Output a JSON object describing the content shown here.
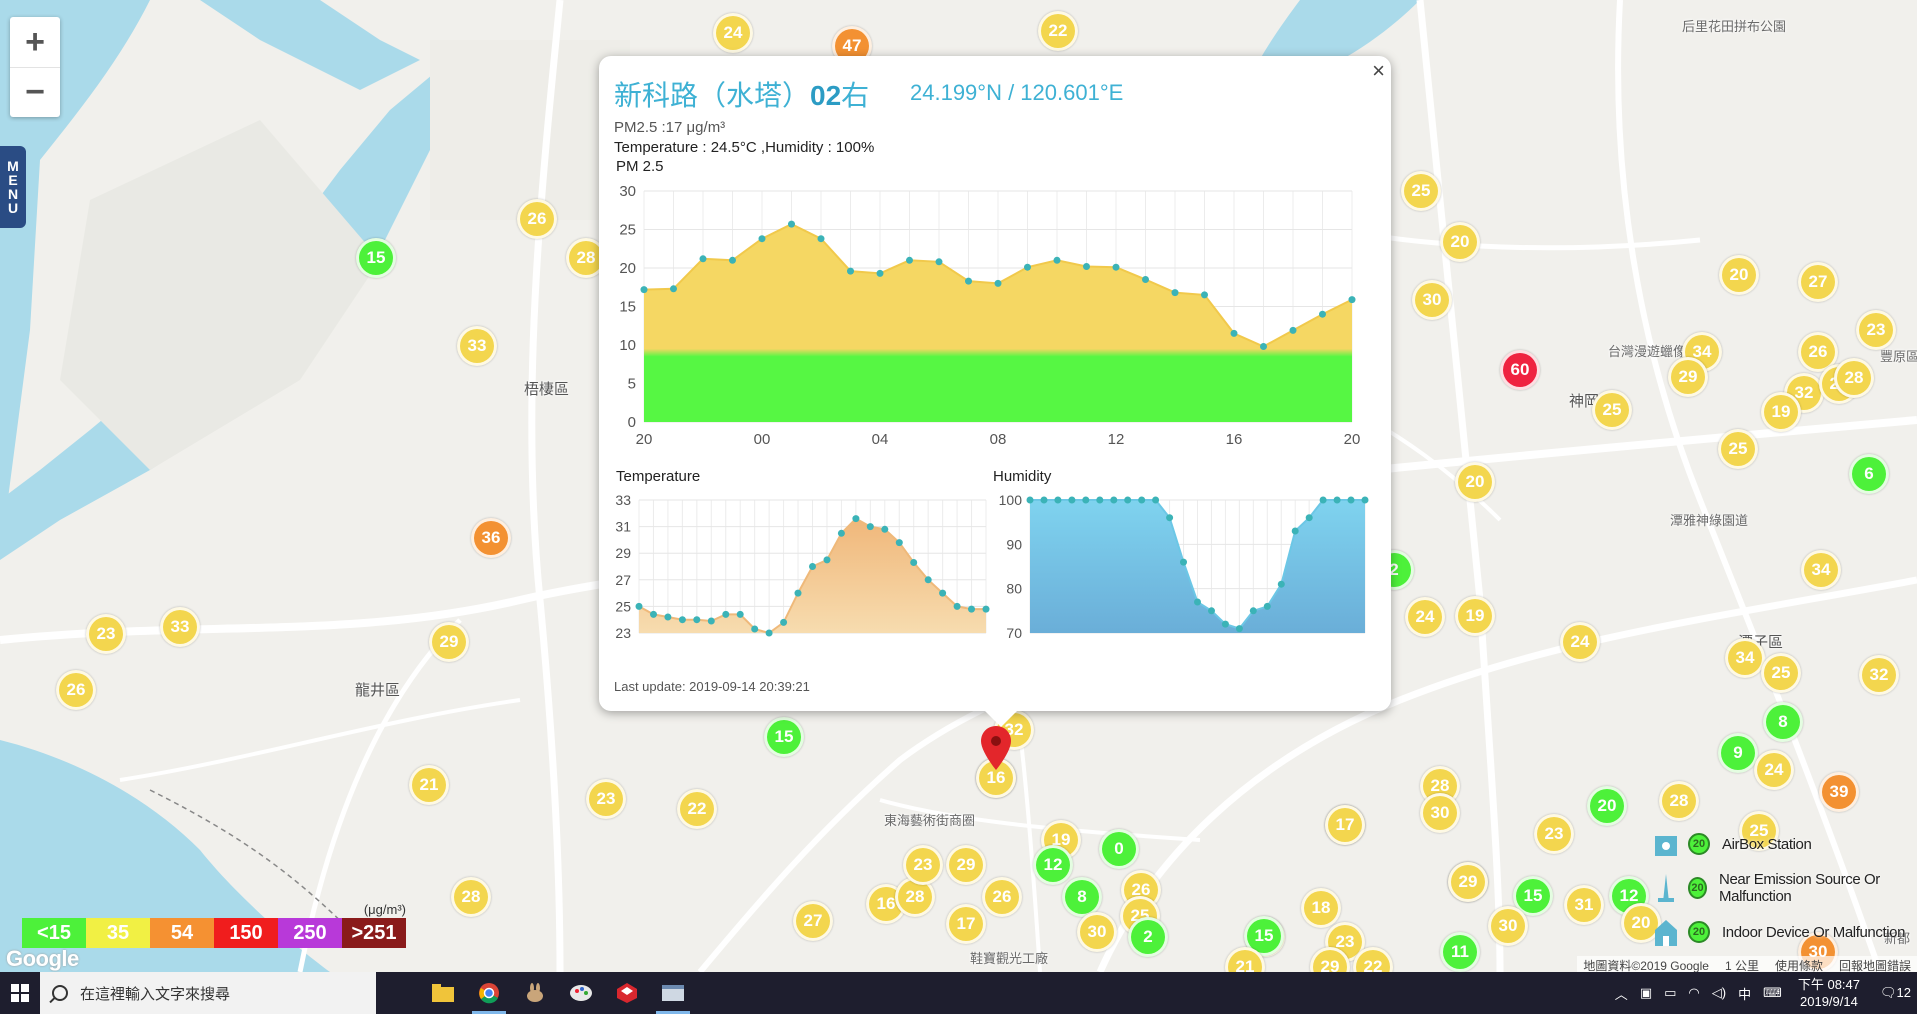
{
  "map": {
    "zoom_in": "+",
    "zoom_out": "−",
    "menu_letters": [
      "M",
      "E",
      "N",
      "U"
    ],
    "labels": [
      {
        "text": "梧棲區"
      },
      {
        "text": "龍井區"
      },
      {
        "text": "神岡"
      },
      {
        "text": "潭子區"
      },
      {
        "text": "潭雅神綠園道"
      },
      {
        "text": "台灣漫遊蠟像館"
      },
      {
        "text": "東海藝術街商圈"
      },
      {
        "text": "后里花田拼布公園"
      },
      {
        "text": "鞋寶觀光工廠"
      },
      {
        "text": "新都"
      },
      {
        "text": "豐原區"
      }
    ],
    "markers": [
      {
        "v": "24",
        "c": "yellow"
      },
      {
        "v": "47",
        "c": "orange"
      },
      {
        "v": "22",
        "c": "yellow"
      },
      {
        "v": "15",
        "c": "green"
      },
      {
        "v": "26",
        "c": "yellow"
      },
      {
        "v": "28",
        "c": "yellow"
      },
      {
        "v": "33",
        "c": "yellow"
      },
      {
        "v": "36",
        "c": "orange"
      },
      {
        "v": "23",
        "c": "yellow"
      },
      {
        "v": "33",
        "c": "yellow"
      },
      {
        "v": "26",
        "c": "yellow"
      },
      {
        "v": "29",
        "c": "yellow"
      },
      {
        "v": "21",
        "c": "yellow"
      },
      {
        "v": "28",
        "c": "yellow"
      },
      {
        "v": "23",
        "c": "yellow"
      },
      {
        "v": "22",
        "c": "yellow"
      },
      {
        "v": "15",
        "c": "green"
      },
      {
        "v": "32",
        "c": "yellow"
      },
      {
        "v": "17",
        "c": "yellow"
      },
      {
        "v": "27",
        "c": "yellow"
      },
      {
        "v": "16",
        "c": "yellow"
      },
      {
        "v": "28",
        "c": "yellow"
      },
      {
        "v": "23",
        "c": "yellow"
      },
      {
        "v": "29",
        "c": "yellow"
      },
      {
        "v": "17",
        "c": "yellow"
      },
      {
        "v": "26",
        "c": "yellow"
      },
      {
        "v": "19",
        "c": "yellow"
      },
      {
        "v": "12",
        "c": "green"
      },
      {
        "v": "0",
        "c": "green"
      },
      {
        "v": "8",
        "c": "green"
      },
      {
        "v": "26",
        "c": "yellow"
      },
      {
        "v": "25",
        "c": "yellow"
      },
      {
        "v": "30",
        "c": "yellow"
      },
      {
        "v": "2",
        "c": "green"
      },
      {
        "v": "30",
        "c": "yellow"
      },
      {
        "v": "15",
        "c": "green"
      },
      {
        "v": "23",
        "c": "yellow"
      },
      {
        "v": "29",
        "c": "yellow"
      },
      {
        "v": "22",
        "c": "yellow"
      },
      {
        "v": "21",
        "c": "yellow"
      },
      {
        "v": "17",
        "c": "yellow"
      },
      {
        "v": "28",
        "c": "yellow"
      },
      {
        "v": "30",
        "c": "yellow"
      },
      {
        "v": "29",
        "c": "yellow"
      },
      {
        "v": "15",
        "c": "green"
      },
      {
        "v": "30",
        "c": "yellow"
      },
      {
        "v": "31",
        "c": "yellow"
      },
      {
        "v": "12",
        "c": "green"
      },
      {
        "v": "20",
        "c": "yellow"
      },
      {
        "v": "11",
        "c": "green"
      },
      {
        "v": "23",
        "c": "yellow"
      },
      {
        "v": "20",
        "c": "green"
      },
      {
        "v": "28",
        "c": "yellow"
      },
      {
        "v": "29",
        "c": "yellow"
      },
      {
        "v": "24",
        "c": "yellow"
      },
      {
        "v": "19",
        "c": "yellow"
      },
      {
        "v": "24",
        "c": "yellow"
      },
      {
        "v": "2",
        "c": "green"
      },
      {
        "v": "20",
        "c": "yellow"
      },
      {
        "v": "25",
        "c": "yellow"
      },
      {
        "v": "20",
        "c": "yellow"
      },
      {
        "v": "30",
        "c": "yellow"
      },
      {
        "v": "60",
        "c": "red"
      },
      {
        "v": "25",
        "c": "yellow"
      },
      {
        "v": "20",
        "c": "yellow"
      },
      {
        "v": "27",
        "c": "yellow"
      },
      {
        "v": "34",
        "c": "yellow"
      },
      {
        "v": "29",
        "c": "yellow"
      },
      {
        "v": "26",
        "c": "yellow"
      },
      {
        "v": "32",
        "c": "yellow"
      },
      {
        "v": "19",
        "c": "yellow"
      },
      {
        "v": "25",
        "c": "yellow"
      },
      {
        "v": "23",
        "c": "yellow"
      },
      {
        "v": "25",
        "c": "yellow"
      },
      {
        "v": "28",
        "c": "yellow"
      },
      {
        "v": "6",
        "c": "green"
      },
      {
        "v": "34",
        "c": "yellow"
      },
      {
        "v": "34",
        "c": "yellow"
      },
      {
        "v": "25",
        "c": "yellow"
      },
      {
        "v": "32",
        "c": "yellow"
      },
      {
        "v": "8",
        "c": "green"
      },
      {
        "v": "9",
        "c": "green"
      },
      {
        "v": "24",
        "c": "yellow"
      },
      {
        "v": "39",
        "c": "orange"
      },
      {
        "v": "25",
        "c": "yellow"
      },
      {
        "v": "30",
        "c": "orange"
      },
      {
        "v": "16",
        "c": "yellow"
      },
      {
        "v": "17",
        "c": "yellow"
      },
      {
        "v": "18",
        "c": "yellow"
      }
    ],
    "google_logo": "Google",
    "attribution": [
      "地圖資料©2019 Google",
      "1 公里",
      "使用條款",
      "回報地圖錯誤"
    ]
  },
  "legend": {
    "unit": "(μg/m³)",
    "items": [
      {
        "label": "<15",
        "color": "#4df13a"
      },
      {
        "label": "35",
        "color": "#f1f044"
      },
      {
        "label": "54",
        "color": "#f59132"
      },
      {
        "label": "150",
        "color": "#f01d1d"
      },
      {
        "label": "250",
        "color": "#b839d9"
      },
      {
        "label": ">251",
        "color": "#8a1b1b"
      }
    ]
  },
  "type_legend": [
    {
      "badge": "20",
      "text": "AirBox Station"
    },
    {
      "badge": "20",
      "text": "Near Emission Source Or Malfunction"
    },
    {
      "badge": "20",
      "text": "Indoor Device Or Malfunction"
    }
  ],
  "popup": {
    "title_prefix": "新科路（水塔）",
    "title_bold": "02",
    "title_suffix": "右",
    "coords": "24.199°N / 120.601°E",
    "pm25_text": "PM2.5 :17 μg/m³",
    "temp_hum_text": "Temperature : 24.5°C ,Humidity : 100%",
    "pm_chart_label": "PM 2.5",
    "temp_chart_label": "Temperature",
    "hum_chart_label": "Humidity",
    "last_update": "Last update: 2019-09-14 20:39:21",
    "close": "×"
  },
  "chart_data": [
    {
      "type": "area",
      "title": "PM 2.5",
      "x_ticks": [
        "20",
        "00",
        "04",
        "08",
        "12",
        "16",
        "20"
      ],
      "ylim": [
        0,
        30
      ],
      "y_ticks": [
        "0",
        "5",
        "10",
        "15",
        "20",
        "25",
        "30"
      ],
      "series": [
        {
          "values": [
            17.2,
            17.3,
            21.2,
            21.0,
            23.8,
            25.7,
            23.8,
            19.6,
            19.3,
            21.0,
            20.8,
            18.3,
            18.0,
            20.1,
            21.0,
            20.2,
            20.1,
            18.5,
            16.8,
            16.5,
            11.5,
            9.8,
            11.9,
            14.0,
            15.9
          ]
        }
      ],
      "threshold": 10.5,
      "grid": true
    },
    {
      "type": "area",
      "title": "Temperature",
      "ylim": [
        23,
        33
      ],
      "y_ticks": [
        "23",
        "25",
        "27",
        "29",
        "31",
        "33"
      ],
      "series": [
        {
          "values": [
            25.0,
            24.4,
            24.2,
            24.0,
            24.0,
            23.9,
            24.4,
            24.4,
            23.3,
            23.0,
            23.8,
            26.0,
            28.0,
            28.5,
            30.5,
            31.6,
            31.0,
            30.8,
            29.8,
            28.3,
            27.0,
            26.0,
            25.0,
            24.8,
            24.8
          ]
        }
      ],
      "grid": true
    },
    {
      "type": "area",
      "title": "Humidity",
      "ylim": [
        70,
        100
      ],
      "y_ticks": [
        "70",
        "80",
        "90",
        "100"
      ],
      "series": [
        {
          "values": [
            100,
            100,
            100,
            100,
            100,
            100,
            100,
            100,
            100,
            100,
            96,
            86,
            77,
            75,
            72,
            71,
            75,
            76,
            81,
            93,
            96,
            100,
            100,
            100,
            100
          ]
        }
      ],
      "grid": true
    }
  ],
  "taskbar": {
    "search_placeholder": "在這裡輸入文字來搜尋",
    "time": "下午 08:47",
    "date": "2019/9/14",
    "ime": "中",
    "notif": "12"
  }
}
